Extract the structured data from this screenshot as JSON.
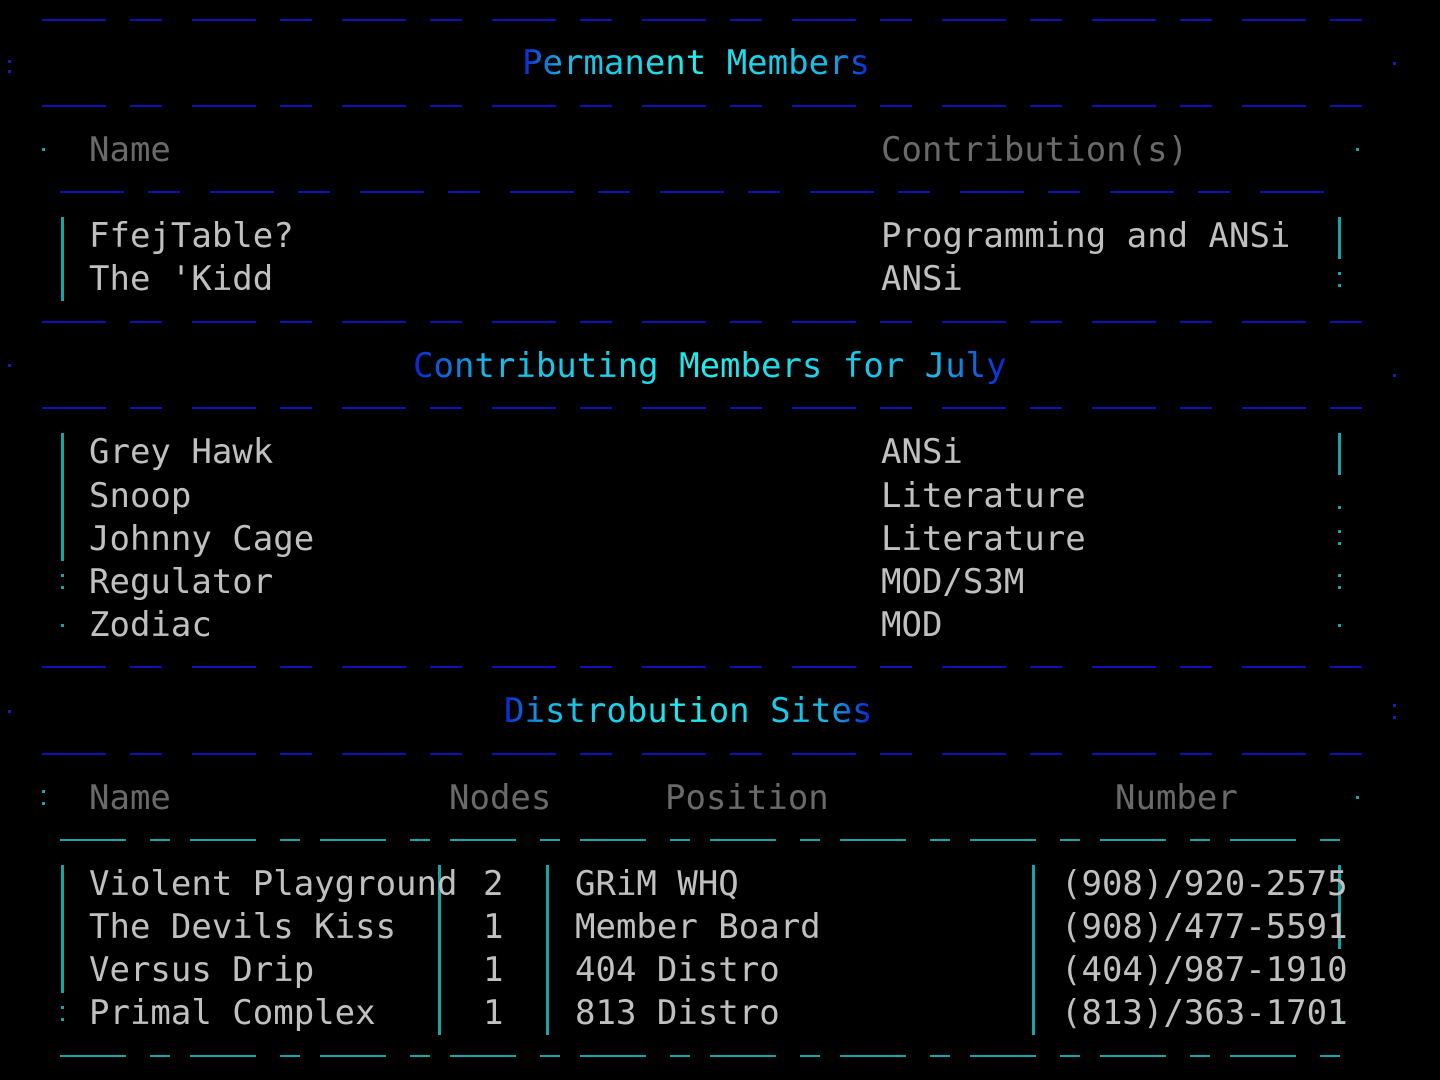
{
  "permanent": {
    "title": "Permanent Members",
    "header_name": "Name",
    "header_contrib": "Contribution(s)",
    "rows": [
      {
        "name": "FfejTable?",
        "contrib": "Programming and ANSi"
      },
      {
        "name": "The 'Kidd",
        "contrib": "ANSi"
      }
    ]
  },
  "contributing": {
    "title": "Contributing Members for July",
    "rows": [
      {
        "name": "Grey Hawk",
        "contrib": "ANSi"
      },
      {
        "name": "Snoop",
        "contrib": "Literature"
      },
      {
        "name": "Johnny Cage",
        "contrib": "Literature"
      },
      {
        "name": "Regulator",
        "contrib": "MOD/S3M"
      },
      {
        "name": "Zodiac",
        "contrib": "MOD"
      }
    ]
  },
  "sites": {
    "title": "Distrobution Sites",
    "header_name": "Name",
    "header_nodes": "Nodes",
    "header_position": "Position",
    "header_number": "Number",
    "rows": [
      {
        "name": "Violent Playground",
        "nodes": "2",
        "position": "GRiM WHQ",
        "number": "(908)/920-2575"
      },
      {
        "name": "The Devils Kiss",
        "nodes": "1",
        "position": "Member Board",
        "number": "(908)/477-5591"
      },
      {
        "name": "Versus Drip",
        "nodes": "1",
        "position": "404 Distro",
        "number": "(404)/987-1910"
      },
      {
        "name": "Primal Complex",
        "nodes": "1",
        "position": "813 Distro",
        "number": "(813)/363-1701"
      }
    ]
  }
}
